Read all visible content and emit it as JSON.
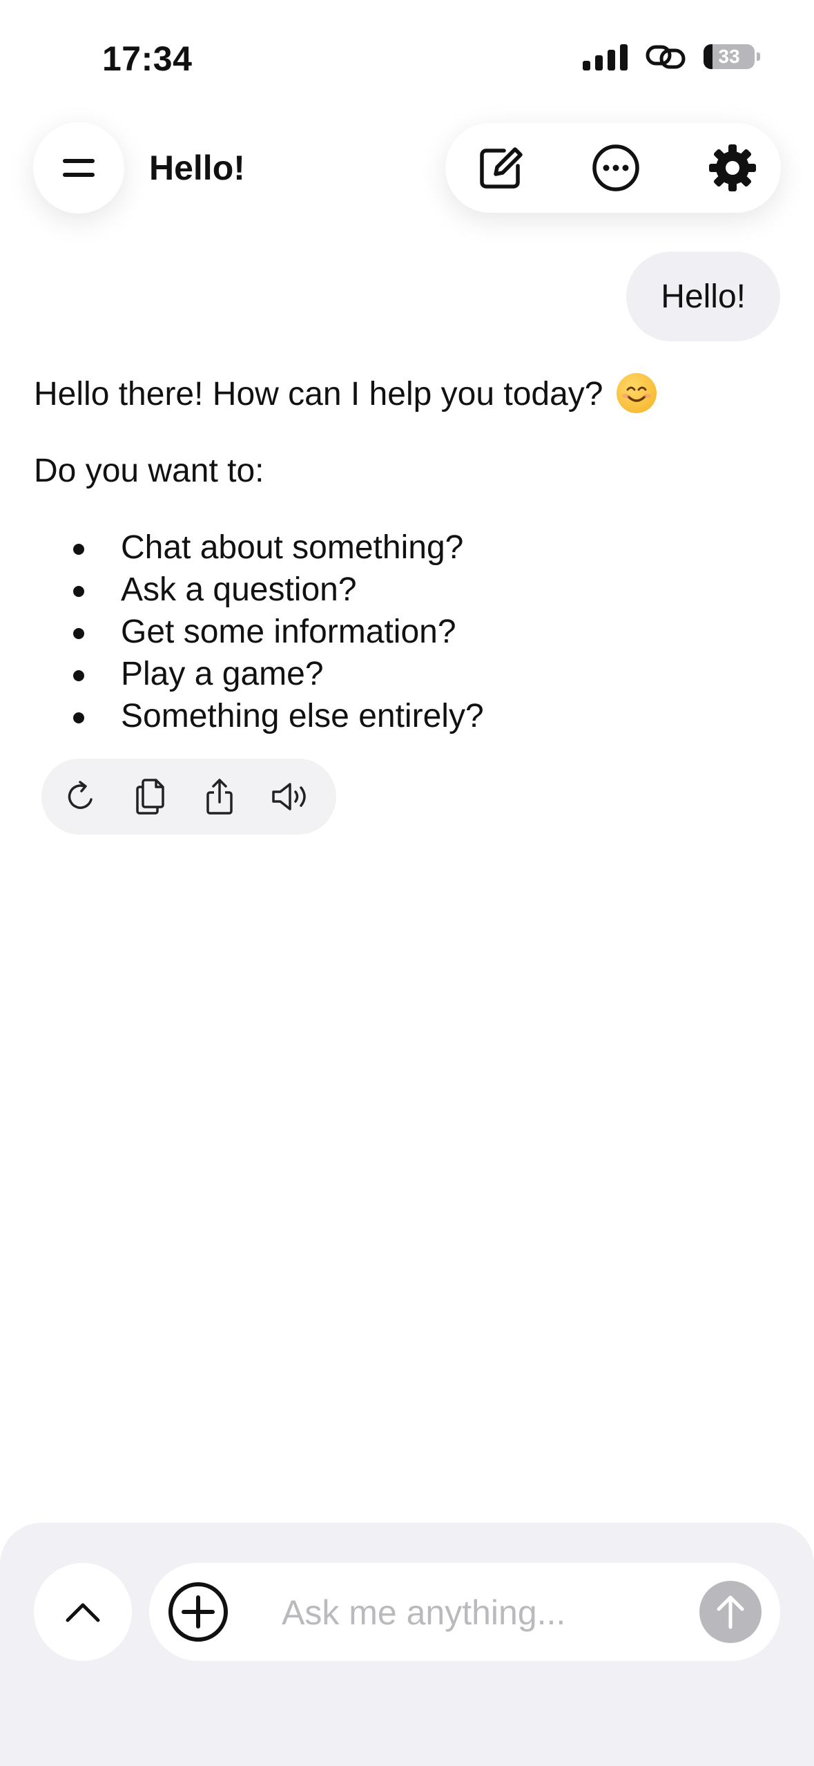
{
  "status_bar": {
    "time": "17:34",
    "battery_level": "33",
    "icons": [
      "cellular-signal-icon",
      "link-icon",
      "battery-icon"
    ]
  },
  "header": {
    "title": "Hello!",
    "menu_icon": "menu-icon",
    "actions": [
      "new-chat-icon",
      "more-icon",
      "settings-icon"
    ]
  },
  "conversation": {
    "user_message": "Hello!",
    "assistant": {
      "greeting": "Hello there! How can I help you today?",
      "emoji": "😊",
      "prompt": "Do you want to:",
      "options": [
        "Chat about something?",
        "Ask a question?",
        "Get some information?",
        "Play a game?",
        "Something else entirely?"
      ]
    },
    "message_actions": [
      "regenerate-icon",
      "copy-icon",
      "share-icon",
      "speak-icon"
    ]
  },
  "composer": {
    "placeholder": "Ask me anything...",
    "value": ""
  },
  "colors": {
    "bubble_bg": "#efeff4",
    "panel_bg": "#f0f0f5",
    "send_disabled": "#b9b9bd",
    "placeholder": "#b9b9be"
  }
}
